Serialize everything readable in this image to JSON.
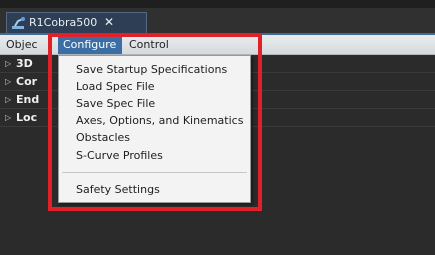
{
  "tab": {
    "title": "R1Cobra500",
    "close_glyph": "✕",
    "icon": "robot-icon"
  },
  "menubar": {
    "objects_label": "Objec",
    "configure_label": "Configure",
    "control_label": "Control"
  },
  "tree": {
    "rows": [
      {
        "label": "3D",
        "expand_glyph": "▷"
      },
      {
        "label": "Cor",
        "expand_glyph": "▷"
      },
      {
        "label": "End",
        "expand_glyph": "▷"
      },
      {
        "label": "Loc",
        "expand_glyph": "▷"
      }
    ]
  },
  "configure_menu": {
    "items": [
      "Save Startup Specifications",
      "Load Spec File",
      "Save Spec File",
      "Axes, Options, and Kinematics",
      "Obstacles",
      "S-Curve Profiles",
      "Safety Settings"
    ]
  },
  "colors": {
    "highlight": "#e2202a",
    "menu_selected": "#3a6ea5",
    "tab_bg": "#2e3f55"
  }
}
